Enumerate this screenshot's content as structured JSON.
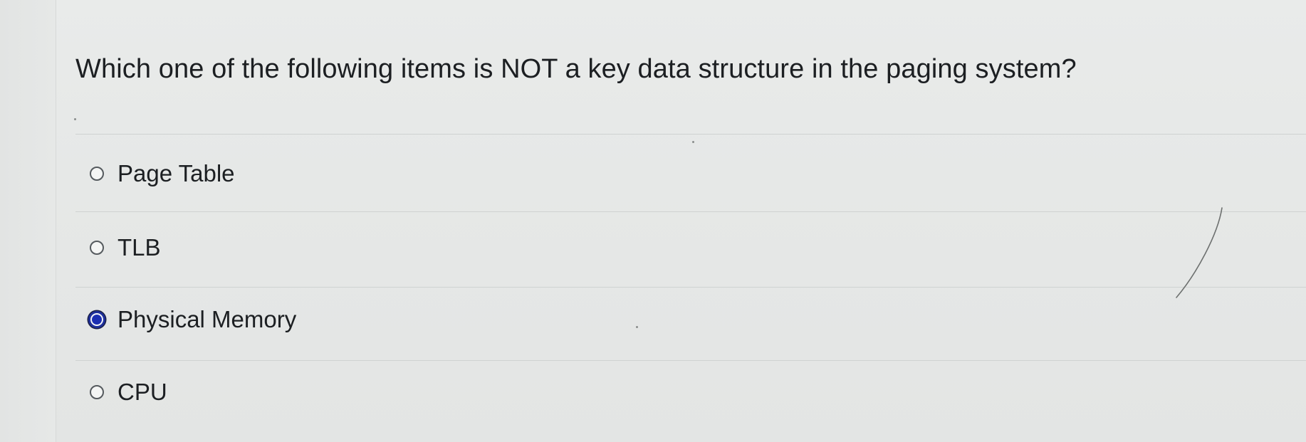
{
  "question": {
    "text": "Which one of the following items is NOT a key data structure in the paging system?"
  },
  "options": [
    {
      "label": "Page Table",
      "selected": false
    },
    {
      "label": "TLB",
      "selected": false
    },
    {
      "label": "Physical Memory",
      "selected": true
    },
    {
      "label": "CPU",
      "selected": false
    }
  ],
  "colors": {
    "background": "#e7e9e8",
    "divider": "#cfd2d1",
    "selected_radio": "#1b2eb2",
    "text": "#1c1f22"
  }
}
